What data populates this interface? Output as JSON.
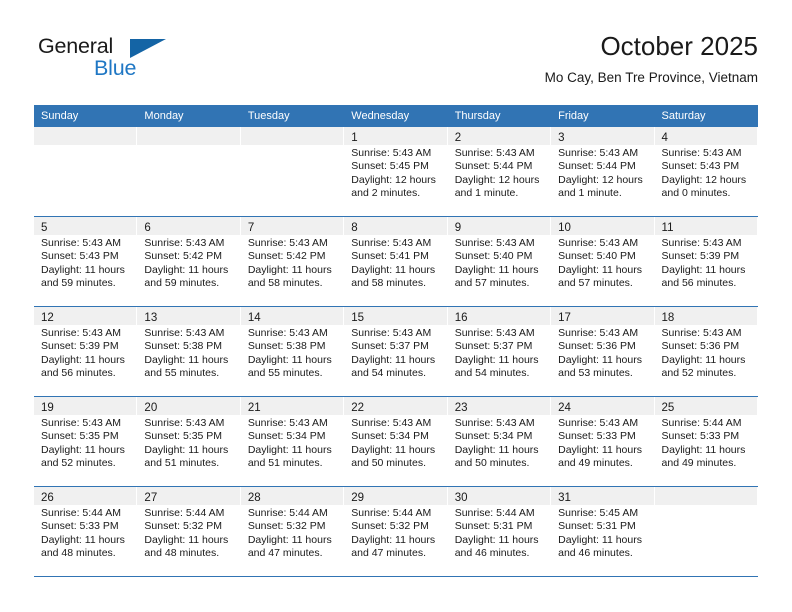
{
  "brand": {
    "name_top": "General",
    "name_bottom": "Blue",
    "triangle_icon": "triangle-logo-icon",
    "colors": {
      "blue": "#1f77c4",
      "dark": "#1a1a1a",
      "triangle": "#1464a5"
    }
  },
  "header": {
    "title": "October 2025",
    "subtitle": "Mo Cay, Ben Tre Province, Vietnam"
  },
  "calendar": {
    "accent_color": "#3174b4",
    "header_text_color": "#ffffff",
    "daynum_band_color": "#f0f0f0",
    "weekdays": [
      "Sunday",
      "Monday",
      "Tuesday",
      "Wednesday",
      "Thursday",
      "Friday",
      "Saturday"
    ],
    "weeks": [
      [
        {
          "day": "",
          "empty": true
        },
        {
          "day": "",
          "empty": true
        },
        {
          "day": "",
          "empty": true
        },
        {
          "day": "1",
          "sunrise": "Sunrise: 5:43 AM",
          "sunset": "Sunset: 5:45 PM",
          "daylight_line1": "Daylight: 12 hours",
          "daylight_line2": "and 2 minutes."
        },
        {
          "day": "2",
          "sunrise": "Sunrise: 5:43 AM",
          "sunset": "Sunset: 5:44 PM",
          "daylight_line1": "Daylight: 12 hours",
          "daylight_line2": "and 1 minute."
        },
        {
          "day": "3",
          "sunrise": "Sunrise: 5:43 AM",
          "sunset": "Sunset: 5:44 PM",
          "daylight_line1": "Daylight: 12 hours",
          "daylight_line2": "and 1 minute."
        },
        {
          "day": "4",
          "sunrise": "Sunrise: 5:43 AM",
          "sunset": "Sunset: 5:43 PM",
          "daylight_line1": "Daylight: 12 hours",
          "daylight_line2": "and 0 minutes."
        }
      ],
      [
        {
          "day": "5",
          "sunrise": "Sunrise: 5:43 AM",
          "sunset": "Sunset: 5:43 PM",
          "daylight_line1": "Daylight: 11 hours",
          "daylight_line2": "and 59 minutes."
        },
        {
          "day": "6",
          "sunrise": "Sunrise: 5:43 AM",
          "sunset": "Sunset: 5:42 PM",
          "daylight_line1": "Daylight: 11 hours",
          "daylight_line2": "and 59 minutes."
        },
        {
          "day": "7",
          "sunrise": "Sunrise: 5:43 AM",
          "sunset": "Sunset: 5:42 PM",
          "daylight_line1": "Daylight: 11 hours",
          "daylight_line2": "and 58 minutes."
        },
        {
          "day": "8",
          "sunrise": "Sunrise: 5:43 AM",
          "sunset": "Sunset: 5:41 PM",
          "daylight_line1": "Daylight: 11 hours",
          "daylight_line2": "and 58 minutes."
        },
        {
          "day": "9",
          "sunrise": "Sunrise: 5:43 AM",
          "sunset": "Sunset: 5:40 PM",
          "daylight_line1": "Daylight: 11 hours",
          "daylight_line2": "and 57 minutes."
        },
        {
          "day": "10",
          "sunrise": "Sunrise: 5:43 AM",
          "sunset": "Sunset: 5:40 PM",
          "daylight_line1": "Daylight: 11 hours",
          "daylight_line2": "and 57 minutes."
        },
        {
          "day": "11",
          "sunrise": "Sunrise: 5:43 AM",
          "sunset": "Sunset: 5:39 PM",
          "daylight_line1": "Daylight: 11 hours",
          "daylight_line2": "and 56 minutes."
        }
      ],
      [
        {
          "day": "12",
          "sunrise": "Sunrise: 5:43 AM",
          "sunset": "Sunset: 5:39 PM",
          "daylight_line1": "Daylight: 11 hours",
          "daylight_line2": "and 56 minutes."
        },
        {
          "day": "13",
          "sunrise": "Sunrise: 5:43 AM",
          "sunset": "Sunset: 5:38 PM",
          "daylight_line1": "Daylight: 11 hours",
          "daylight_line2": "and 55 minutes."
        },
        {
          "day": "14",
          "sunrise": "Sunrise: 5:43 AM",
          "sunset": "Sunset: 5:38 PM",
          "daylight_line1": "Daylight: 11 hours",
          "daylight_line2": "and 55 minutes."
        },
        {
          "day": "15",
          "sunrise": "Sunrise: 5:43 AM",
          "sunset": "Sunset: 5:37 PM",
          "daylight_line1": "Daylight: 11 hours",
          "daylight_line2": "and 54 minutes."
        },
        {
          "day": "16",
          "sunrise": "Sunrise: 5:43 AM",
          "sunset": "Sunset: 5:37 PM",
          "daylight_line1": "Daylight: 11 hours",
          "daylight_line2": "and 54 minutes."
        },
        {
          "day": "17",
          "sunrise": "Sunrise: 5:43 AM",
          "sunset": "Sunset: 5:36 PM",
          "daylight_line1": "Daylight: 11 hours",
          "daylight_line2": "and 53 minutes."
        },
        {
          "day": "18",
          "sunrise": "Sunrise: 5:43 AM",
          "sunset": "Sunset: 5:36 PM",
          "daylight_line1": "Daylight: 11 hours",
          "daylight_line2": "and 52 minutes."
        }
      ],
      [
        {
          "day": "19",
          "sunrise": "Sunrise: 5:43 AM",
          "sunset": "Sunset: 5:35 PM",
          "daylight_line1": "Daylight: 11 hours",
          "daylight_line2": "and 52 minutes."
        },
        {
          "day": "20",
          "sunrise": "Sunrise: 5:43 AM",
          "sunset": "Sunset: 5:35 PM",
          "daylight_line1": "Daylight: 11 hours",
          "daylight_line2": "and 51 minutes."
        },
        {
          "day": "21",
          "sunrise": "Sunrise: 5:43 AM",
          "sunset": "Sunset: 5:34 PM",
          "daylight_line1": "Daylight: 11 hours",
          "daylight_line2": "and 51 minutes."
        },
        {
          "day": "22",
          "sunrise": "Sunrise: 5:43 AM",
          "sunset": "Sunset: 5:34 PM",
          "daylight_line1": "Daylight: 11 hours",
          "daylight_line2": "and 50 minutes."
        },
        {
          "day": "23",
          "sunrise": "Sunrise: 5:43 AM",
          "sunset": "Sunset: 5:34 PM",
          "daylight_line1": "Daylight: 11 hours",
          "daylight_line2": "and 50 minutes."
        },
        {
          "day": "24",
          "sunrise": "Sunrise: 5:43 AM",
          "sunset": "Sunset: 5:33 PM",
          "daylight_line1": "Daylight: 11 hours",
          "daylight_line2": "and 49 minutes."
        },
        {
          "day": "25",
          "sunrise": "Sunrise: 5:44 AM",
          "sunset": "Sunset: 5:33 PM",
          "daylight_line1": "Daylight: 11 hours",
          "daylight_line2": "and 49 minutes."
        }
      ],
      [
        {
          "day": "26",
          "sunrise": "Sunrise: 5:44 AM",
          "sunset": "Sunset: 5:33 PM",
          "daylight_line1": "Daylight: 11 hours",
          "daylight_line2": "and 48 minutes."
        },
        {
          "day": "27",
          "sunrise": "Sunrise: 5:44 AM",
          "sunset": "Sunset: 5:32 PM",
          "daylight_line1": "Daylight: 11 hours",
          "daylight_line2": "and 48 minutes."
        },
        {
          "day": "28",
          "sunrise": "Sunrise: 5:44 AM",
          "sunset": "Sunset: 5:32 PM",
          "daylight_line1": "Daylight: 11 hours",
          "daylight_line2": "and 47 minutes."
        },
        {
          "day": "29",
          "sunrise": "Sunrise: 5:44 AM",
          "sunset": "Sunset: 5:32 PM",
          "daylight_line1": "Daylight: 11 hours",
          "daylight_line2": "and 47 minutes."
        },
        {
          "day": "30",
          "sunrise": "Sunrise: 5:44 AM",
          "sunset": "Sunset: 5:31 PM",
          "daylight_line1": "Daylight: 11 hours",
          "daylight_line2": "and 46 minutes."
        },
        {
          "day": "31",
          "sunrise": "Sunrise: 5:45 AM",
          "sunset": "Sunset: 5:31 PM",
          "daylight_line1": "Daylight: 11 hours",
          "daylight_line2": "and 46 minutes."
        },
        {
          "day": "",
          "empty": true
        }
      ]
    ]
  }
}
